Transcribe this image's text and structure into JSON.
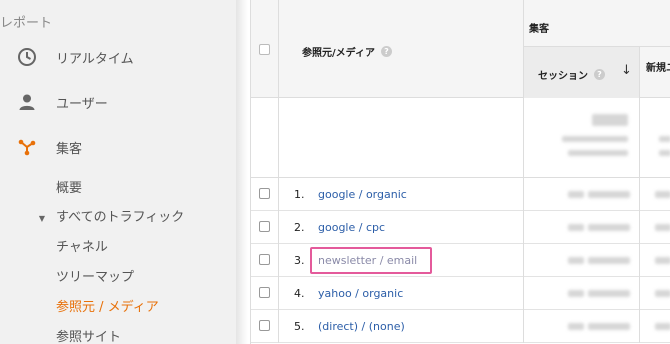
{
  "sidebar": {
    "header": "レポート",
    "items": [
      {
        "label": "リアルタイム",
        "icon": "clock-icon"
      },
      {
        "label": "ユーザー",
        "icon": "person-icon"
      },
      {
        "label": "集客",
        "icon": "acquisition-icon"
      }
    ],
    "sub_items": {
      "overview": "概要",
      "all_traffic": "すべてのトラフィック",
      "channels": "チャネル",
      "treemaps": "ツリーマップ",
      "source_medium": "参照元 / メディア",
      "referrals": "参照サイト"
    },
    "active_color": "#e8710a"
  },
  "table": {
    "dimension_header": "参照元/メディア",
    "group_header": "集客",
    "metric_sessions": "セッション",
    "metric_new": "新規ユ",
    "rows": [
      {
        "index": "1.",
        "source": "google / organic"
      },
      {
        "index": "2.",
        "source": "google / cpc"
      },
      {
        "index": "3.",
        "source": "newsletter / email"
      },
      {
        "index": "4.",
        "source": "yahoo / organic"
      },
      {
        "index": "5.",
        "source": "(direct) / (none)"
      }
    ],
    "highlight_color": "#e45a9b",
    "link_color": "#2c5ea8"
  }
}
